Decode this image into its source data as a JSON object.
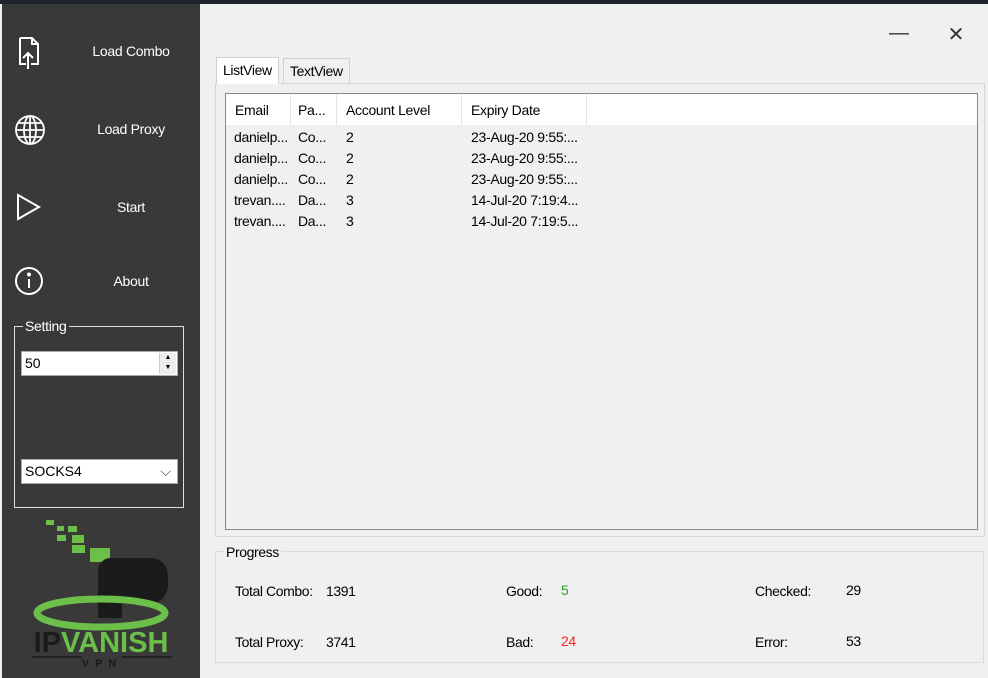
{
  "sidebar": {
    "items": [
      {
        "label": "Load Combo",
        "icon": "file-upload-icon"
      },
      {
        "label": "Load Proxy",
        "icon": "globe-icon"
      },
      {
        "label": "Start",
        "icon": "play-icon"
      },
      {
        "label": "About",
        "icon": "info-icon"
      }
    ],
    "setting": {
      "title": "Setting",
      "threads": "50",
      "proxy_type": "SOCKS4"
    },
    "logo": {
      "text": "IPVANISH",
      "sub": "VPN",
      "color": "#6cc04a"
    }
  },
  "window": {
    "minimize": "—",
    "close": "✕"
  },
  "tabs": [
    {
      "label": "ListView",
      "active": true
    },
    {
      "label": "TextView",
      "active": false
    }
  ],
  "list": {
    "columns": [
      "Email",
      "Pa...",
      "Account Level",
      "Expiry Date"
    ],
    "rows": [
      [
        "danielp...",
        "Co...",
        "2",
        "23-Aug-20 9:55:..."
      ],
      [
        "danielp...",
        "Co...",
        "2",
        "23-Aug-20 9:55:..."
      ],
      [
        "danielp...",
        "Co...",
        "2",
        "23-Aug-20 9:55:..."
      ],
      [
        "trevan....",
        "Da...",
        "3",
        "14-Jul-20 7:19:4..."
      ],
      [
        "trevan....",
        "Da...",
        "3",
        "14-Jul-20 7:19:5..."
      ]
    ]
  },
  "progress": {
    "title": "Progress",
    "total_combo_label": "Total Combo:",
    "total_combo": "1391",
    "total_proxy_label": "Total Proxy:",
    "total_proxy": "3741",
    "good_label": "Good:",
    "good": "5",
    "good_color": "#2ca02c",
    "bad_label": "Bad:",
    "bad": "24",
    "bad_color": "#ff2020",
    "checked_label": "Checked:",
    "checked": "29",
    "error_label": "Error:",
    "error": "53"
  }
}
